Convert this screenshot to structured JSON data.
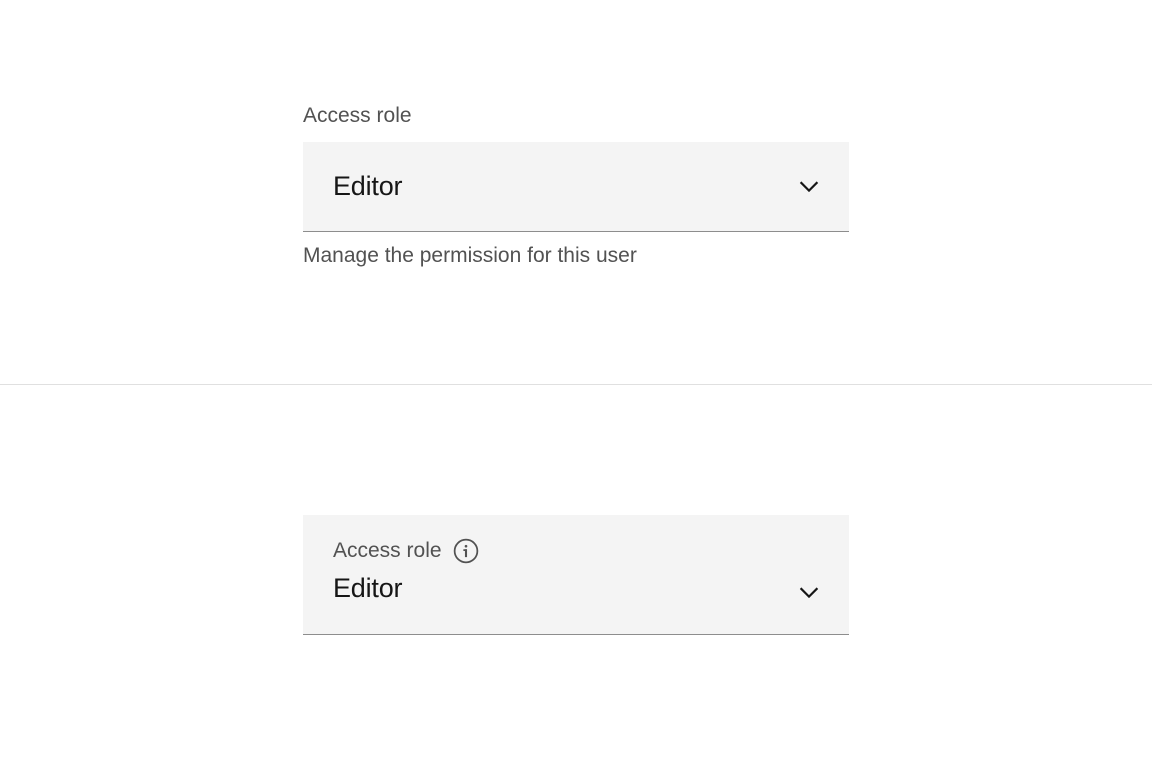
{
  "select1": {
    "label": "Access role",
    "value": "Editor",
    "helper": "Manage the permission for this user"
  },
  "select2": {
    "label": "Access role",
    "value": "Editor"
  }
}
